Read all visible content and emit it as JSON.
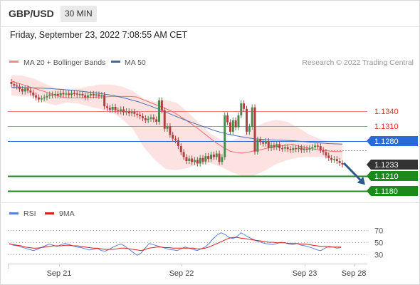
{
  "header": {
    "pair": "GBP/USD",
    "timeframe": "30 MIN"
  },
  "datetime": "Friday, September 23, 2022 7:08:55 AM CET",
  "legend": [
    {
      "label": "MA 20 + Bollinger Bands",
      "color": "#f28a8a"
    },
    {
      "label": "MA 50",
      "color": "#3a6aa8"
    }
  ],
  "credit": "Research © 2022 Trading Central",
  "colors": {
    "resistance": "#f08080",
    "pivot": "#2a6ad8",
    "support": "#1a8a1a",
    "price_tag": "#333333",
    "bollinger_fill": "#fde2e2",
    "ma20": "#f07070",
    "ma50": "#4a72b0",
    "up_candle": "#4a8a4a",
    "down_candle": "#b04040",
    "arrow": "#2b5a8a",
    "rsi": "#5b7fd8",
    "rsi_ma": "#d82020"
  },
  "levels": [
    {
      "label": "1.1340",
      "value": 1.134,
      "kind": "resistance"
    },
    {
      "label": "1.1310",
      "value": 1.131,
      "kind": "resistance"
    },
    {
      "label": "1.1280",
      "value": 1.128,
      "kind": "pivot"
    },
    {
      "label": "1.1233",
      "value": 1.1233,
      "kind": "price"
    },
    {
      "label": "1.1210",
      "value": 1.121,
      "kind": "support"
    },
    {
      "label": "1.1180",
      "value": 1.118,
      "kind": "support"
    }
  ],
  "x_axis": {
    "ticks": [
      "Sep 21",
      "Sep 22",
      "Sep 23",
      "Sep 28"
    ]
  },
  "rsi_panel": {
    "legend": [
      {
        "label": "RSI",
        "color": "#5b7fd8"
      },
      {
        "label": "9MA",
        "color": "#d82020"
      }
    ],
    "ticks": [
      "70",
      "50",
      "30"
    ]
  },
  "chart_data": {
    "type": "candlestick",
    "price_range": [
      1.1164,
      1.1425
    ],
    "close": [
      1.1395,
      1.1392,
      1.139,
      1.1385,
      1.138,
      1.1386,
      1.1382,
      1.1378,
      1.1372,
      1.1368,
      1.1364,
      1.1366,
      1.1368,
      1.1371,
      1.1374,
      1.1372,
      1.1375,
      1.1372,
      1.1377,
      1.1374,
      1.1376,
      1.1373,
      1.1377,
      1.1376,
      1.1374,
      1.1375,
      1.1372,
      1.1368,
      1.1372,
      1.1375,
      1.1372,
      1.1374,
      1.1371,
      1.1373,
      1.135,
      1.1347,
      1.1343,
      1.1349,
      1.1342,
      1.134,
      1.1344,
      1.1338,
      1.134,
      1.1336,
      1.1339,
      1.1335,
      1.1333,
      1.133,
      1.1326,
      1.1322,
      1.1325,
      1.1328,
      1.1324,
      1.1319,
      1.1362,
      1.1342,
      1.1305,
      1.131,
      1.1293,
      1.1285,
      1.1282,
      1.127,
      1.1258,
      1.1248,
      1.124,
      1.1245,
      1.1238,
      1.1242,
      1.1235,
      1.1246,
      1.1239,
      1.125,
      1.1244,
      1.1253,
      1.1248,
      1.1255,
      1.1238,
      1.1248,
      1.1332,
      1.1318,
      1.1299,
      1.1322,
      1.1308,
      1.1332,
      1.1356,
      1.1345,
      1.1299,
      1.1309,
      1.1348,
      1.1259,
      1.1283,
      1.1278,
      1.1275,
      1.128,
      1.1266,
      1.1272,
      1.1268,
      1.1274,
      1.1266,
      1.1265,
      1.1268,
      1.1264,
      1.1262,
      1.1266,
      1.1264,
      1.1267,
      1.1262,
      1.1265,
      1.1263,
      1.1266,
      1.1268,
      1.1271,
      1.127,
      1.1262,
      1.1258,
      1.1251,
      1.1246,
      1.1242,
      1.1244,
      1.124,
      1.1236,
      1.1233
    ],
    "ma20": [
      1.1401,
      1.1397,
      1.1393,
      1.1389,
      1.1385,
      1.1381,
      1.1377,
      1.1373,
      1.1369,
      1.1367,
      1.1367,
      1.1367,
      1.1368,
      1.1368,
      1.1369,
      1.1369,
      1.137,
      1.137,
      1.137,
      1.137,
      1.1369,
      1.1364,
      1.1359,
      1.1354,
      1.1349,
      1.1344,
      1.1338,
      1.133,
      1.1322,
      1.1313,
      1.1304,
      1.1294,
      1.1284,
      1.1275,
      1.1267,
      1.126,
      1.1257,
      1.1256,
      1.1258,
      1.1261,
      1.1263,
      1.1266,
      1.1268,
      1.127,
      1.1272,
      1.1274,
      1.127,
      1.1268,
      1.1265,
      1.1263,
      1.1262,
      1.126,
      1.1259,
      1.1259
    ],
    "ma50": [
      1.1388,
      1.1388,
      1.1387,
      1.1386,
      1.1384,
      1.1382,
      1.1379,
      1.1376,
      1.1372,
      1.1366,
      1.1359,
      1.135,
      1.134,
      1.1329,
      1.1319,
      1.131,
      1.1301,
      1.1294,
      1.1289,
      1.1285,
      1.1283,
      1.1282,
      1.1281,
      1.1279,
      1.1277,
      1.1275,
      1.1274
    ],
    "bb_upper": [
      1.1413,
      1.1412,
      1.1406,
      1.1396,
      1.1387,
      1.1385,
      1.1386,
      1.139,
      1.1394,
      1.1394,
      1.139,
      1.1381,
      1.1365,
      1.1359,
      1.1363,
      1.1357,
      1.1338,
      1.1317,
      1.1296,
      1.1283,
      1.1281,
      1.1291,
      1.1307,
      1.1318,
      1.1323,
      1.1319,
      1.1307,
      1.1293,
      1.1284,
      1.1279,
      1.1277
    ],
    "bb_lower": [
      1.1372,
      1.137,
      1.137,
      1.1358,
      1.1352,
      1.1358,
      1.1356,
      1.135,
      1.1345,
      1.134,
      1.1325,
      1.1305,
      1.1268,
      1.1242,
      1.1224,
      1.1222,
      1.1226,
      1.1234,
      1.1236,
      1.1228,
      1.1217,
      1.1209,
      1.1211,
      1.1221,
      1.1234,
      1.1242,
      1.1247,
      1.1248,
      1.1248,
      1.1245,
      1.1243
    ],
    "forecast_target": 1.1195,
    "rsi": [
      48,
      45,
      44,
      42,
      40,
      38,
      36,
      38,
      41,
      44,
      47,
      45,
      43,
      46,
      48,
      46,
      44,
      42,
      41,
      39,
      37,
      38,
      40,
      36,
      35,
      38,
      42,
      45,
      47,
      43,
      38,
      33,
      28,
      32,
      40,
      48,
      46,
      44,
      42,
      40,
      38,
      37,
      36,
      39,
      42,
      40,
      38,
      36,
      39,
      42,
      48,
      56,
      62,
      66,
      63,
      58,
      56,
      60,
      66,
      62,
      58,
      55,
      52,
      50,
      48,
      47,
      46,
      48,
      50,
      49,
      47,
      46,
      48,
      45,
      44,
      42,
      40,
      37,
      36,
      40,
      43,
      42,
      40,
      41
    ],
    "rsi_ma": [
      47,
      46,
      45,
      44,
      42,
      41,
      40,
      40,
      41,
      42,
      43,
      44,
      44,
      44,
      45,
      45,
      44,
      44,
      43,
      42,
      41,
      40,
      40,
      39,
      38,
      38,
      38,
      39,
      40,
      40,
      39,
      38,
      37,
      36,
      38,
      40,
      41,
      42,
      42,
      41,
      41,
      40,
      40,
      40,
      40,
      40,
      40,
      39,
      39,
      40,
      42,
      45,
      48,
      51,
      54,
      57,
      58,
      58,
      57,
      56,
      55,
      54,
      53,
      52,
      51,
      50,
      50,
      49,
      49,
      49,
      48,
      48,
      48,
      47,
      47,
      46,
      45,
      44,
      43,
      43,
      42,
      42,
      42,
      42
    ],
    "rsi_range": [
      20,
      80
    ]
  }
}
